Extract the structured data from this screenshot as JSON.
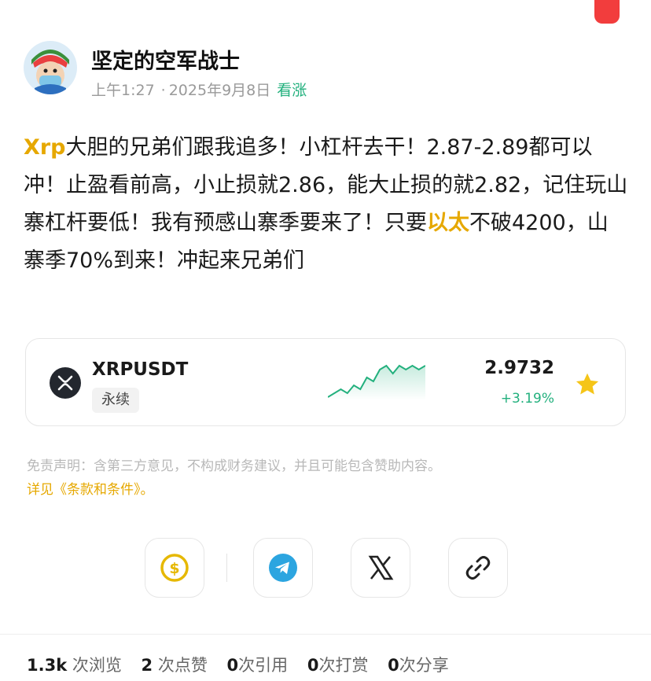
{
  "author": {
    "name": "坚定的空军战士",
    "time": "上午1:27",
    "date": "2025年9月8日",
    "sentiment": "看涨"
  },
  "post": {
    "part1_hl": "Xrp",
    "part1": "大胆的兄弟们跟我追多！小杠杆去干！2.87-2.89都可以冲！止盈看前高，小止损就2.86，能大止损的就2.82，记住玩山寨杠杆要低！我有预感山寨季要来了！只要",
    "part2_hl": "以太",
    "part2": "不破4200，山寨季70%到来！冲起来兄弟们"
  },
  "ticker": {
    "symbol": "XRPUSDT",
    "tag": "永续",
    "price": "2.9732",
    "change": "+3.19%",
    "trend": [
      2,
      3,
      4,
      3,
      5,
      4,
      7,
      6,
      9,
      10,
      8,
      10,
      9,
      10,
      9,
      10
    ],
    "colors": {
      "up": "#22b07d",
      "star": "#f5c518"
    }
  },
  "disclaimer": "免责声明：含第三方意见，不构成财务建议，并且可能包含赞助内容。",
  "terms": "详见《条款和条件》。",
  "share_icons": [
    "tip-dollar-icon",
    "telegram-icon",
    "x-icon",
    "link-icon"
  ],
  "stats": {
    "views_num": "1.3k",
    "views_label": "次浏览",
    "likes_num": "2",
    "likes_label": "次点赞",
    "quotes_num": "0",
    "quotes_label": "次引用",
    "tips_num": "0",
    "tips_label": "次打赏",
    "shares_num": "0",
    "shares_label": "次分享"
  }
}
